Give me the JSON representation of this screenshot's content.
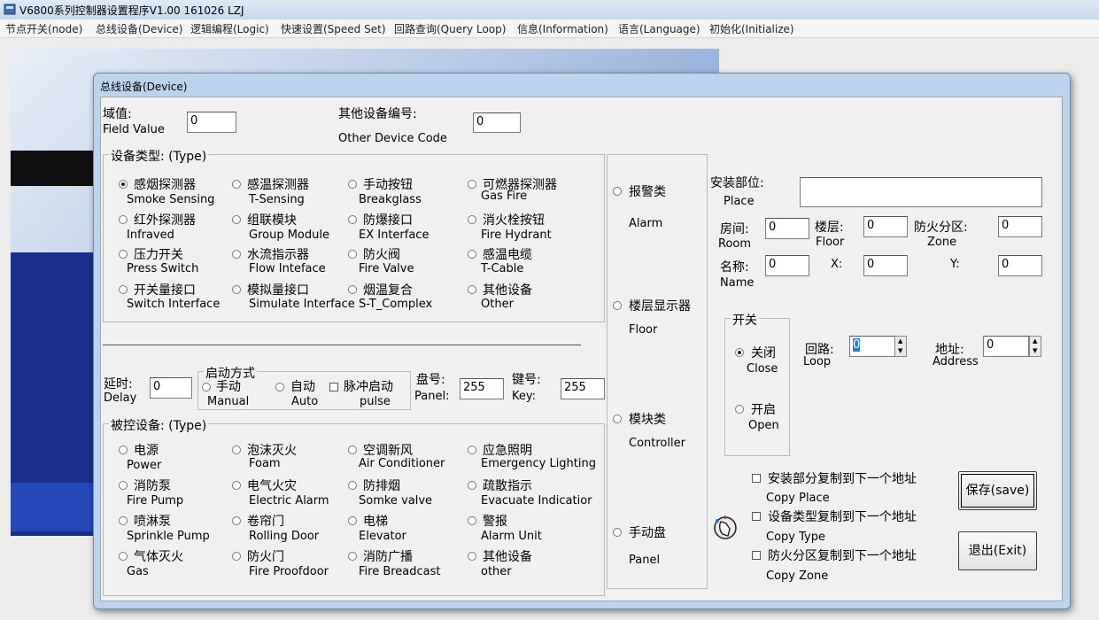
{
  "app": {
    "title": "V6800系列控制器设置程序V1.00 161026 LZJ"
  },
  "menu": [
    "节点开关(node)",
    "总线设备(Device)",
    "逻辑编程(Logic)",
    "快速设置(Speed Set)",
    "回路查询(Query Loop)",
    "信息(Information)",
    "语言(Language)",
    "初始化(Initialize)"
  ],
  "dialog": {
    "title": "总线设备(Device)",
    "field_value": {
      "cn": "域值:",
      "en": "Field Value",
      "value": "0"
    },
    "other_code": {
      "cn": "其他设备编号:",
      "en": "Other Device  Code",
      "value": "0"
    },
    "device_type": {
      "title": "设备类型: (Type)",
      "items": [
        {
          "cn": "感烟探测器",
          "en": "Smoke Sensing"
        },
        {
          "cn": "感温探测器",
          "en": "T-Sensing"
        },
        {
          "cn": "手动按钮",
          "en": "Breakglass"
        },
        {
          "cn": "可燃器探测器",
          "en": "Gas Fire"
        },
        {
          "cn": "红外探测器",
          "en": "Infraved"
        },
        {
          "cn": "组联模块",
          "en": "Group Module"
        },
        {
          "cn": "防爆接口",
          "en": "EX Interface"
        },
        {
          "cn": "消火栓按钮",
          "en": "Fire Hydrant"
        },
        {
          "cn": "压力开关",
          "en": "Press Switch"
        },
        {
          "cn": "水流指示器",
          "en": "Flow Inteface"
        },
        {
          "cn": "防火阀",
          "en": "Fire Valve"
        },
        {
          "cn": "感温电缆",
          "en": "T-Cable"
        },
        {
          "cn": "开关量接口",
          "en": "Switch Interface"
        },
        {
          "cn": "模拟量接口",
          "en": "Simulate Interface"
        },
        {
          "cn": "烟温复合",
          "en": "S-T_Complex"
        },
        {
          "cn": "其他设备",
          "en": "Other"
        }
      ]
    },
    "delay": {
      "cn": "延时:",
      "en": "Delay",
      "value": "0"
    },
    "start_mode": {
      "title": "启动方式",
      "manual": {
        "cn": "手动",
        "en": "Manual"
      },
      "auto": {
        "cn": "自动",
        "en": "Auto"
      },
      "pulse": {
        "cn": "脉冲启动",
        "en": "pulse"
      }
    },
    "panel": {
      "cn": "盘号:",
      "en": "Panel:",
      "value": "255"
    },
    "key": {
      "cn": "键号:",
      "en": "Key:",
      "value": "255"
    },
    "controlled": {
      "title": "被控设备: (Type)",
      "items": [
        {
          "cn": "电源",
          "en": "Power"
        },
        {
          "cn": "泡沫灭火",
          "en": "Foam"
        },
        {
          "cn": "空调新风",
          "en": "Air Conditioner"
        },
        {
          "cn": "应急照明",
          "en": "Emergency Lighting"
        },
        {
          "cn": "消防泵",
          "en": "Fire Pump"
        },
        {
          "cn": "电气火灾",
          "en": "Electric Alarm"
        },
        {
          "cn": "防排烟",
          "en": "Somke valve"
        },
        {
          "cn": "疏散指示",
          "en": "Evacuate Indicatior"
        },
        {
          "cn": "喷淋泵",
          "en": "Sprinkle Pump"
        },
        {
          "cn": "卷帘门",
          "en": "Rolling Door"
        },
        {
          "cn": "电梯",
          "en": "Elevator"
        },
        {
          "cn": "警报",
          "en": "Alarm Unit"
        },
        {
          "cn": "气体灭火",
          "en": "Gas"
        },
        {
          "cn": "防火门",
          "en": "Fire Proofdoor"
        },
        {
          "cn": "消防广播",
          "en": "Fire Breadcast"
        },
        {
          "cn": "其他设备",
          "en": "other"
        }
      ]
    },
    "category": [
      {
        "cn": "报警类",
        "en": "Alarm"
      },
      {
        "cn": "楼层显示器",
        "en": "Floor"
      },
      {
        "cn": "模块类",
        "en": "Controller"
      },
      {
        "cn": "手动盘",
        "en": "Panel"
      }
    ],
    "place": {
      "cn": "安装部位:",
      "en": "Place",
      "value": ""
    },
    "room": {
      "cn": "房间:",
      "en": "Room",
      "value": "0"
    },
    "floor": {
      "cn": "楼层:",
      "en": "Floor",
      "value": "0"
    },
    "zone": {
      "cn": "防火分区:",
      "en": "Zone",
      "value": "0"
    },
    "name": {
      "cn": "名称:",
      "en": "Name",
      "value": "0"
    },
    "x": {
      "label": "X:",
      "value": "0"
    },
    "y": {
      "label": "Y:",
      "value": "0"
    },
    "switch": {
      "title": "开关",
      "close": {
        "cn": "关闭",
        "en": "Close"
      },
      "open": {
        "cn": "开启",
        "en": "Open"
      }
    },
    "loop": {
      "cn": "回路:",
      "en": "Loop",
      "value": "0"
    },
    "address": {
      "cn": "地址:",
      "en": "Address",
      "value": "0"
    },
    "copy_place": {
      "cn": "安装部分复制到下一个地址",
      "en": "Copy  Place"
    },
    "copy_type": {
      "cn": "设备类型复制到下一个地址",
      "en": "Copy  Type"
    },
    "copy_zone": {
      "cn": "防火分区复制到下一个地址",
      "en": "Copy  Zone"
    },
    "save_label": "保存(save)",
    "exit_label": "退出(Exit)"
  }
}
